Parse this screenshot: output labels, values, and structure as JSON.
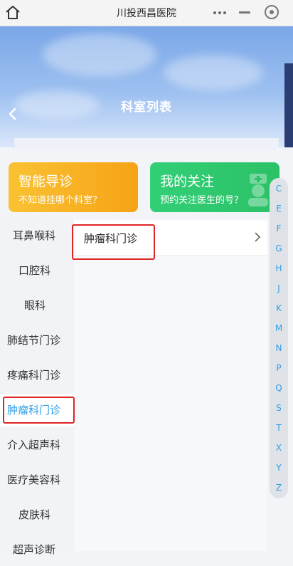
{
  "window": {
    "title": "川投西昌医院"
  },
  "header": {
    "title": "科室列表"
  },
  "cards": [
    {
      "title": "智能导诊",
      "subtitle": "不知道挂哪个科室？",
      "color": "#f7b024"
    },
    {
      "title": "我的关注",
      "subtitle": "预约关注医生的号？",
      "color": "#30c86f"
    }
  ],
  "departments": [
    {
      "label": "耳鼻喉科"
    },
    {
      "label": "口腔科"
    },
    {
      "label": "眼科"
    },
    {
      "label": "肺结节门诊"
    },
    {
      "label": "疼痛科门诊"
    },
    {
      "label": "肿瘤科门诊",
      "active": true
    },
    {
      "label": "介入超声科"
    },
    {
      "label": "医疗美容科"
    },
    {
      "label": "皮肤科"
    },
    {
      "label": "超声诊断"
    }
  ],
  "sub_departments": [
    {
      "label": "肿瘤科门诊"
    }
  ],
  "alphabet": [
    "C",
    "E",
    "F",
    "G",
    "H",
    "J",
    "K",
    "M",
    "N",
    "P",
    "Q",
    "S",
    "T",
    "X",
    "Y",
    "Z"
  ],
  "colors": {
    "accent": "#2f9fe6",
    "highlight": "#e02424"
  }
}
